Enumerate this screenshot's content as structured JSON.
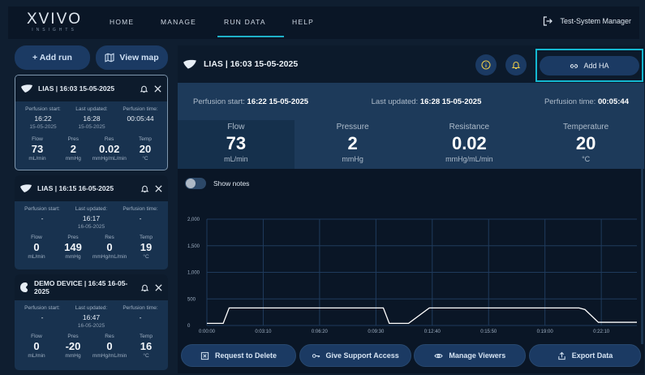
{
  "nav": {
    "logo": "XVIVO",
    "logo_sub": "INSIGHTS",
    "items": [
      "HOME",
      "MANAGE",
      "RUN DATA",
      "HELP"
    ],
    "active": "RUN DATA",
    "user": "Test-System Manager"
  },
  "sidebar": {
    "add_run": "+ Add run",
    "view_map": "View map",
    "cards": [
      {
        "title": "LIAS | 16:03 15-05-2025",
        "perfusion_start_label": "Perfusion start:",
        "perfusion_start_time": "16:22",
        "perfusion_start_date": "15-05-2025",
        "last_updated_label": "Last updated:",
        "last_updated_time": "16:28",
        "last_updated_date": "15-05-2025",
        "perfusion_time_label": "Perfusion time:",
        "perfusion_time": "00:05:44",
        "flow": "73",
        "pres": "2",
        "res": "0.02",
        "temp": "20"
      },
      {
        "title": "LIAS | 16:15 16-05-2025",
        "perfusion_start_label": "Perfusion start:",
        "perfusion_start_time": "-",
        "perfusion_start_date": "",
        "last_updated_label": "Last updated:",
        "last_updated_time": "16:17",
        "last_updated_date": "16-05-2025",
        "perfusion_time_label": "Perfusion time:",
        "perfusion_time": "-",
        "flow": "0",
        "pres": "149",
        "res": "0",
        "temp": "19"
      },
      {
        "title": "DEMO DEVICE | 16:45 16-05-2025",
        "perfusion_start_label": "Perfusion start:",
        "perfusion_start_time": "-",
        "perfusion_start_date": "",
        "last_updated_label": "Last updated:",
        "last_updated_time": "16:47",
        "last_updated_date": "16-05-2025",
        "perfusion_time_label": "Perfusion time:",
        "perfusion_time": "-",
        "flow": "0",
        "pres": "-20",
        "res": "0",
        "temp": "16"
      }
    ],
    "metric_labels": [
      "Flow",
      "Pres",
      "Res",
      "Temp"
    ],
    "metric_units": [
      "mL/min",
      "mmHg",
      "mmHg/mL/min",
      "°C"
    ]
  },
  "main": {
    "title": "LIAS | 16:03 15-05-2025",
    "add_ha": "Add HA",
    "summary": {
      "perfusion_start_label": "Perfusion start:",
      "perfusion_start": "16:22  15-05-2025",
      "last_updated_label": "Last updated:",
      "last_updated": "16:28  15-05-2025",
      "perfusion_time_label": "Perfusion time:",
      "perfusion_time": "00:05:44"
    },
    "metrics": [
      {
        "label": "Flow",
        "value": "73",
        "unit": "mL/min"
      },
      {
        "label": "Pressure",
        "value": "2",
        "unit": "mmHg"
      },
      {
        "label": "Resistance",
        "value": "0.02",
        "unit": "mmHg/mL/min"
      },
      {
        "label": "Temperature",
        "value": "20",
        "unit": "°C"
      }
    ],
    "show_notes": "Show notes",
    "actions": [
      "Request to Delete",
      "Give Support Access",
      "Manage Viewers",
      "Export Data"
    ]
  },
  "chart_data": {
    "type": "line",
    "title": "",
    "xlabel": "",
    "ylabel": "",
    "y_ticks": [
      "0",
      "500",
      "1,000",
      "1,500",
      "2,000"
    ],
    "x_ticks": [
      "0:00:00",
      "0:03:10",
      "0:06:20",
      "0:09:30",
      "0:12:40",
      "0:15:50",
      "0:19:00",
      "0:22:10"
    ],
    "ylim": [
      0,
      2000
    ],
    "xlim_seconds": [
      0,
      1450
    ],
    "grid": true,
    "series": [
      {
        "x_seconds": [
          0,
          55,
          75,
          155,
          570,
          595,
          615,
          640,
          680,
          750,
          1200,
          1230,
          1255,
          1275,
          1320,
          1380,
          1450
        ],
        "values": [
          40,
          40,
          330,
          330,
          330,
          330,
          40,
          40,
          40,
          330,
          330,
          330,
          330,
          300,
          60,
          60,
          60
        ]
      }
    ],
    "line_color": "#ffffff"
  },
  "colors": {
    "accent": "#14b8d1",
    "button": "#1b3a63",
    "panel": "#1d3a5a",
    "background": "#0f1e30"
  }
}
